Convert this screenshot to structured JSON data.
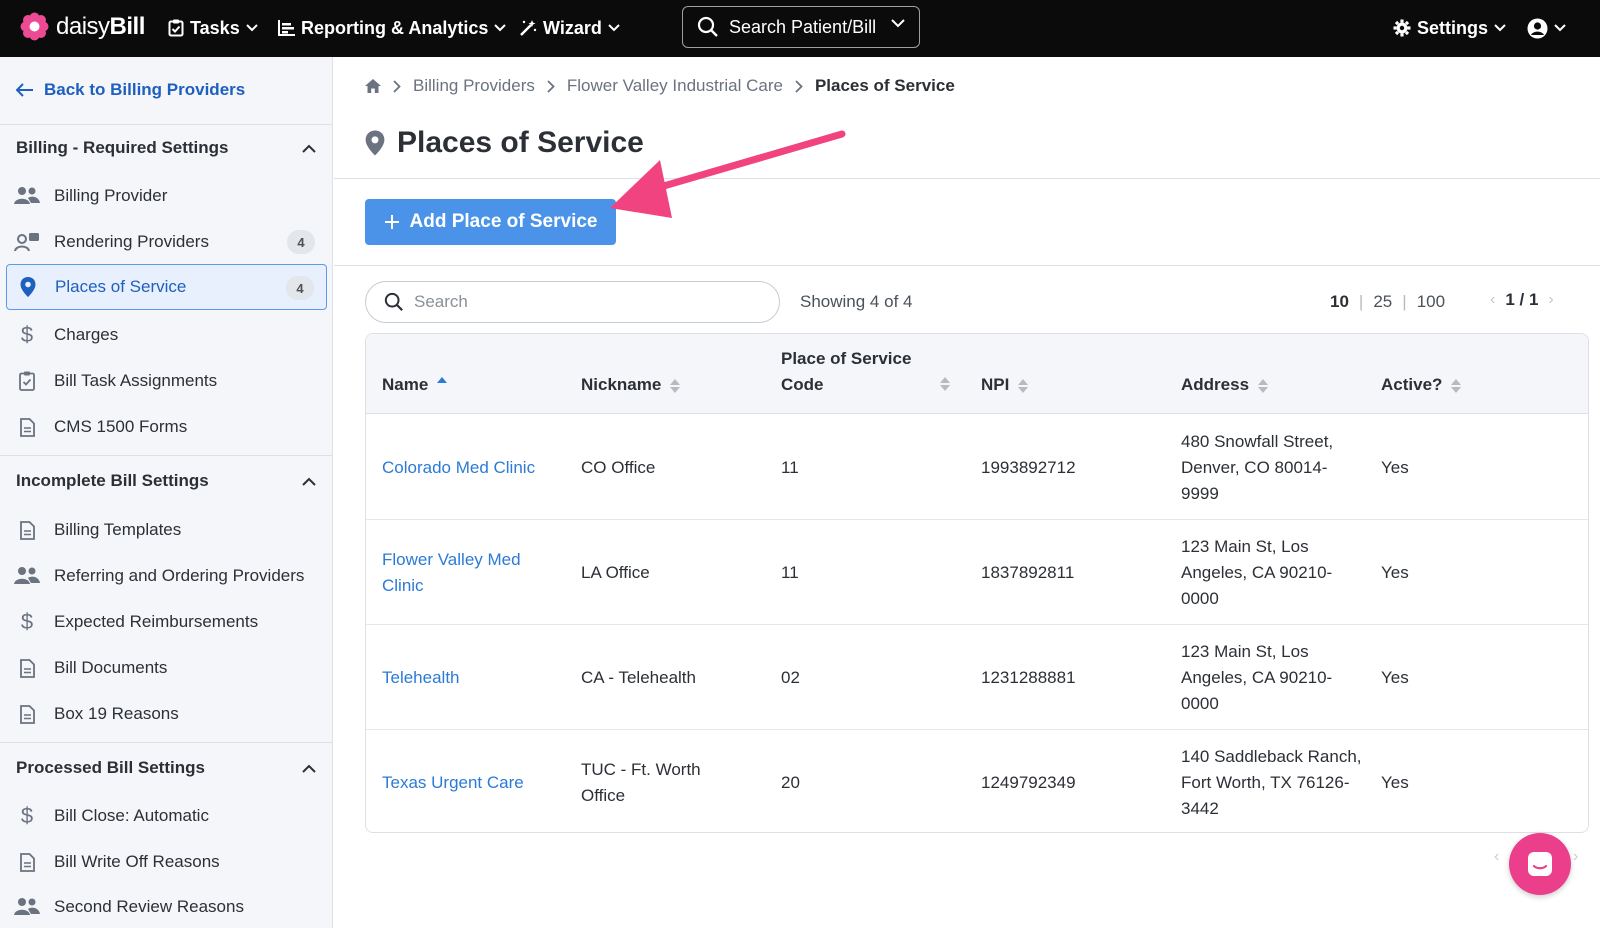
{
  "app": {
    "name_prefix": "daisy",
    "name_suffix": "Bill"
  },
  "topnav": {
    "tasks": "Tasks",
    "reporting": "Reporting & Analytics",
    "wizard": "Wizard",
    "search": "Search Patient/Bill",
    "settings": "Settings"
  },
  "sidebar": {
    "back": "Back to Billing Providers",
    "sections": [
      {
        "title": "Billing - Required Settings"
      },
      {
        "title": "Incomplete Bill Settings"
      },
      {
        "title": "Processed Bill Settings"
      }
    ],
    "required": [
      {
        "label": "Billing Provider",
        "icon": "users-icon"
      },
      {
        "label": "Rendering Providers",
        "icon": "user-card-icon",
        "count": "4"
      },
      {
        "label": "Places of Service",
        "icon": "map-pin-icon",
        "count": "4"
      },
      {
        "label": "Charges",
        "icon": "dollar-icon"
      },
      {
        "label": "Bill Task Assignments",
        "icon": "clipboard-check-icon"
      },
      {
        "label": "CMS 1500 Forms",
        "icon": "document-icon"
      }
    ],
    "incomplete": [
      {
        "label": "Billing Templates",
        "icon": "document-icon"
      },
      {
        "label": "Referring and Ordering Providers",
        "icon": "users-icon"
      },
      {
        "label": "Expected Reimbursements",
        "icon": "dollar-icon"
      },
      {
        "label": "Bill Documents",
        "icon": "document-icon"
      },
      {
        "label": "Box 19 Reasons",
        "icon": "document-icon"
      }
    ],
    "processed": [
      {
        "label": "Bill Close: Automatic",
        "icon": "dollar-icon"
      },
      {
        "label": "Bill Write Off Reasons",
        "icon": "document-icon"
      },
      {
        "label": "Second Review Reasons",
        "icon": "users-icon"
      }
    ]
  },
  "breadcrumb": {
    "items": [
      "Billing Providers",
      "Flower Valley Industrial Care"
    ],
    "current": "Places of Service"
  },
  "page": {
    "title": "Places of Service",
    "add_button": "Add Place of Service"
  },
  "list": {
    "search_placeholder": "Search",
    "showing": "Showing 4 of 4",
    "page_sizes": [
      "10",
      "25",
      "100"
    ],
    "pager": "1 / 1"
  },
  "table": {
    "headers": {
      "name": "Name",
      "nickname": "Nickname",
      "pos_code_1": "Place of Service",
      "pos_code_2": "Code",
      "npi": "NPI",
      "address": "Address",
      "active": "Active?"
    },
    "rows": [
      {
        "name": "Colorado Med Clinic",
        "nickname": "CO Office",
        "code": "11",
        "npi": "1993892712",
        "address": "480 Snowfall Street, Denver, CO 80014-9999",
        "active": "Yes"
      },
      {
        "name": "Flower Valley Med Clinic",
        "nickname": "LA Office",
        "code": "11",
        "npi": "1837892811",
        "address": "123 Main St, Los Angeles, CA 90210-0000",
        "active": "Yes"
      },
      {
        "name": "Telehealth",
        "nickname": "CA - Telehealth",
        "code": "02",
        "npi": "1231288881",
        "address": "123 Main St, Los Angeles, CA 90210-0000",
        "active": "Yes"
      },
      {
        "name": "Texas Urgent Care",
        "nickname": "TUC - Ft. Worth Office",
        "code": "20",
        "npi": "1249792349",
        "address": "140 Saddleback Ranch, Fort Worth, TX 76126-3442",
        "active": "Yes"
      }
    ]
  },
  "colors": {
    "accent": "#4a93e8",
    "link": "#2b7bd6",
    "callout_arrow": "#f0437f",
    "chat": "#ec3f8b"
  }
}
